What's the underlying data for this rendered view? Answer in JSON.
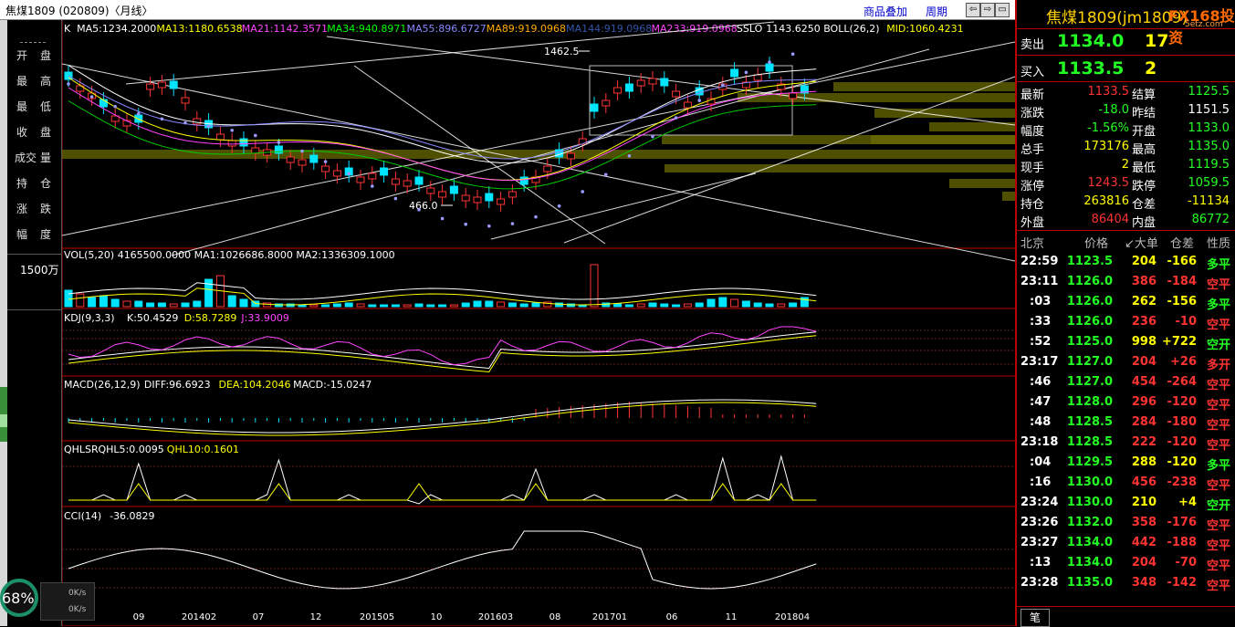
{
  "window": {
    "title": "焦煤1809 (020809)〈月线〉",
    "links": [
      "商品叠加",
      "周期"
    ],
    "nav_buttons": [
      "⇦",
      "⇨",
      "▭",
      "✕"
    ]
  },
  "left_panel": {
    "labels": [
      [
        "开",
        "盘"
      ],
      [
        "最",
        "高"
      ],
      [
        "最",
        "低"
      ],
      [
        "收",
        "盘"
      ],
      [
        "成交",
        "量"
      ],
      [
        "持",
        "仓"
      ],
      [
        "涨",
        "跌"
      ],
      [
        "幅",
        "度"
      ]
    ],
    "volume_scale": "1500万"
  },
  "main_chart": {
    "legend": [
      {
        "text": "K",
        "color": "#ffffff"
      },
      {
        "text": "MA5:1234.2000",
        "color": "#ffffff"
      },
      {
        "text": "MA13:1180.6538",
        "color": "#ffff00"
      },
      {
        "text": "MA21:1142.3571",
        "color": "#ff44ff"
      },
      {
        "text": "MA34:940.8971",
        "color": "#00ff00"
      },
      {
        "text": "MA55:896.6727",
        "color": "#8888ff"
      },
      {
        "text": "MA89:919.0968",
        "color": "#ffaa00"
      },
      {
        "text": "MA144:919.0968",
        "color": "#3355aa"
      },
      {
        "text": "MA233:919.0968",
        "color": "#ff44ff"
      },
      {
        "text": "SSLO",
        "color": "#ffffff"
      },
      {
        "text": "1143.6250",
        "color": "#ffffff"
      },
      {
        "text": "BOLL(26,2)",
        "color": "#ffffff"
      },
      {
        "text": "MID:1060.4231",
        "color": "#ffff00"
      }
    ],
    "high_marker": "1462.5",
    "low_marker": "466.0"
  },
  "chart_data": {
    "type": "candlestick",
    "x_ticks": [
      "09",
      "201402",
      "07",
      "12",
      "201505",
      "10",
      "201603",
      "08",
      "201701",
      "06",
      "11",
      "201804"
    ],
    "high": 1462.5,
    "low": 466.0,
    "vol_panel": {
      "legend": "VOL(5,20) 4165500.0000  MA1:1026686.8000  MA2:1336309.1000"
    },
    "kdj_panel": {
      "legend_parts": [
        {
          "text": "KDJ(9,3,3)",
          "color": "#ffffff"
        },
        {
          "text": "K:50.4529",
          "color": "#ffffff"
        },
        {
          "text": "D:58.7289",
          "color": "#ffff00"
        },
        {
          "text": "J:33.9009",
          "color": "#ff44ff"
        }
      ],
      "yticks": [
        "100",
        "80",
        "50",
        "20"
      ]
    },
    "macd_panel": {
      "legend_parts": [
        {
          "text": "MACD(26,12,9)",
          "color": "#ffffff"
        },
        {
          "text": "DIFF:96.6923",
          "color": "#ffffff"
        },
        {
          "text": "DEA:104.2046",
          "color": "#ffff00"
        },
        {
          "text": "MACD:-15.0247",
          "color": "#ffffff"
        }
      ],
      "yticks": [
        "0"
      ]
    },
    "qhlsr_panel": {
      "legend_parts": [
        {
          "text": "QHLSR",
          "color": "#ffffff"
        },
        {
          "text": "QHL5:0.0095",
          "color": "#ffffff"
        },
        {
          "text": "QHL10:0.1601",
          "color": "#ffff00"
        }
      ],
      "yticks": [
        "0.8"
      ]
    },
    "cci_panel": {
      "legend_parts": [
        {
          "text": "CCI(14)",
          "color": "#ffffff"
        },
        {
          "text": "-36.0829",
          "color": "#ffffff"
        }
      ],
      "yticks": [
        "100",
        "0",
        "-100"
      ]
    }
  },
  "right_panel": {
    "name": "焦煤1809(jm1809)",
    "logo": "FX168投资",
    "logo_sub": "5etz.com",
    "ask": {
      "label": "卖出",
      "price": "1134.0",
      "qty": "17"
    },
    "bid": {
      "label": "买入",
      "price": "1133.5",
      "qty": "2"
    },
    "quotes": [
      {
        "l1": "最新",
        "v1": "1133.5",
        "c1": "#ff3333",
        "l2": "结算",
        "v2": "1125.5",
        "c2": "#22ff22"
      },
      {
        "l1": "涨跌",
        "v1": "-18.0",
        "c1": "#22ff22",
        "l2": "昨结",
        "v2": "1151.5",
        "c2": "#ffffff"
      },
      {
        "l1": "幅度",
        "v1": "-1.56%",
        "c1": "#22ff22",
        "l2": "开盘",
        "v2": "1133.0",
        "c2": "#22ff22"
      },
      {
        "l1": "总手",
        "v1": "173176",
        "c1": "#ffff00",
        "l2": "最高",
        "v2": "1135.0",
        "c2": "#22ff22"
      },
      {
        "l1": "现手",
        "v1": "2",
        "c1": "#ffff00",
        "l2": "最低",
        "v2": "1119.5",
        "c2": "#22ff22"
      },
      {
        "l1": "涨停",
        "v1": "1243.5",
        "c1": "#ff3333",
        "l2": "跌停",
        "v2": "1059.5",
        "c2": "#22ff22"
      },
      {
        "l1": "持仓",
        "v1": "263816",
        "c1": "#ffff00",
        "l2": "仓差",
        "v2": "-11134",
        "c2": "#ffff00"
      },
      {
        "l1": "外盘",
        "v1": "86404",
        "c1": "#ff3333",
        "l2": "内盘",
        "v2": "86772",
        "c2": "#22ff22"
      }
    ],
    "tick_headers": [
      "北京",
      "价格",
      "↙大单",
      "仓差",
      "性质"
    ],
    "ticks": [
      {
        "time": "22:59",
        "price": "1123.5",
        "vol": "204",
        "vc": "#ffff00",
        "chg": "-166",
        "nature": "多平",
        "nc": "#22ff22"
      },
      {
        "time": "23:11",
        "price": "1126.0",
        "vol": "386",
        "vc": "#ff3333",
        "chg": "-184",
        "nature": "空平",
        "nc": "#ff3333"
      },
      {
        "time": ":03",
        "price": "1126.0",
        "vol": "262",
        "vc": "#ffff00",
        "chg": "-156",
        "nature": "多平",
        "nc": "#22ff22"
      },
      {
        "time": ":33",
        "price": "1126.0",
        "vol": "236",
        "vc": "#ff3333",
        "chg": "-10",
        "nature": "空平",
        "nc": "#ff3333"
      },
      {
        "time": ":52",
        "price": "1125.0",
        "vol": "998",
        "vc": "#ffff00",
        "chg": "+722",
        "nature": "空开",
        "nc": "#22ff22"
      },
      {
        "time": "23:17",
        "price": "1127.0",
        "vol": "204",
        "vc": "#ff3333",
        "chg": "+26",
        "nature": "多开",
        "nc": "#ff3333"
      },
      {
        "time": ":46",
        "price": "1127.0",
        "vol": "454",
        "vc": "#ff3333",
        "chg": "-264",
        "nature": "空平",
        "nc": "#ff3333"
      },
      {
        "time": ":47",
        "price": "1128.0",
        "vol": "296",
        "vc": "#ff3333",
        "chg": "-120",
        "nature": "空平",
        "nc": "#ff3333"
      },
      {
        "time": ":48",
        "price": "1128.5",
        "vol": "284",
        "vc": "#ff3333",
        "chg": "-180",
        "nature": "空平",
        "nc": "#ff3333"
      },
      {
        "time": "23:18",
        "price": "1128.5",
        "vol": "222",
        "vc": "#ff3333",
        "chg": "-120",
        "nature": "空平",
        "nc": "#ff3333"
      },
      {
        "time": ":04",
        "price": "1129.5",
        "vol": "288",
        "vc": "#ffff00",
        "chg": "-120",
        "nature": "多平",
        "nc": "#22ff22"
      },
      {
        "time": ":16",
        "price": "1130.0",
        "vol": "456",
        "vc": "#ff3333",
        "chg": "-238",
        "nature": "空平",
        "nc": "#ff3333"
      },
      {
        "time": "23:24",
        "price": "1130.0",
        "vol": "210",
        "vc": "#ffff00",
        "chg": "+4",
        "nature": "空开",
        "nc": "#22ff22"
      },
      {
        "time": "23:26",
        "price": "1132.0",
        "vol": "358",
        "vc": "#ff3333",
        "chg": "-176",
        "nature": "空平",
        "nc": "#ff3333"
      },
      {
        "time": "23:27",
        "price": "1134.0",
        "vol": "442",
        "vc": "#ff3333",
        "chg": "-188",
        "nature": "空平",
        "nc": "#ff3333"
      },
      {
        "time": ":13",
        "price": "1134.0",
        "vol": "204",
        "vc": "#ff3333",
        "chg": "-70",
        "nature": "空平",
        "nc": "#ff3333"
      },
      {
        "time": "23:28",
        "price": "1135.0",
        "vol": "348",
        "vc": "#ff3333",
        "chg": "-142",
        "nature": "空平",
        "nc": "#ff3333"
      }
    ],
    "footer_tab": "笔"
  },
  "speed_widget": {
    "percent": "68%",
    "up": "0K/s",
    "down": "0K/s"
  }
}
